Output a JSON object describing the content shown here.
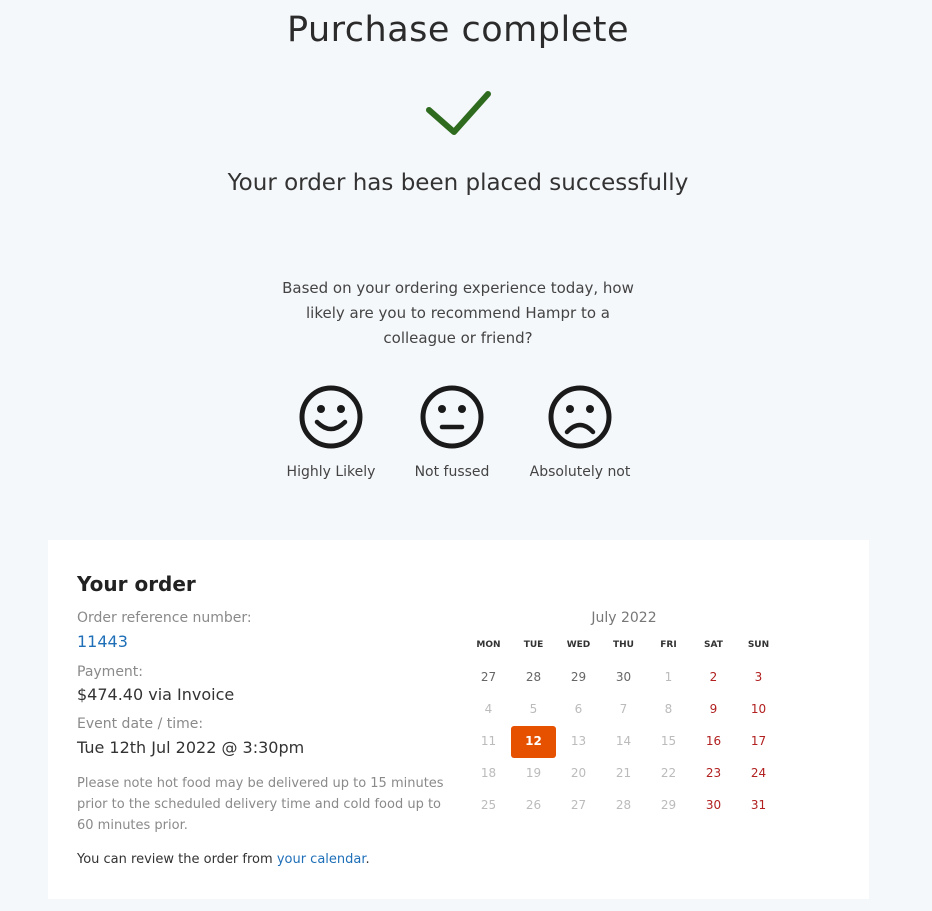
{
  "header": {
    "title": "Purchase complete",
    "subtitle": "Your order has been placed successfully",
    "check_color": "#2e6b1f"
  },
  "survey": {
    "question": "Based on your ordering experience today, how likely are you to recommend Hampr to a colleague or friend?",
    "options": [
      {
        "label": "Highly Likely",
        "icon": "happy-face-icon"
      },
      {
        "label": "Not fussed",
        "icon": "neutral-face-icon"
      },
      {
        "label": "Absolutely not",
        "icon": "sad-face-icon"
      }
    ]
  },
  "order": {
    "title": "Your order",
    "reference_label": "Order reference number:",
    "reference_value": "11443",
    "payment_label": "Payment:",
    "payment_value": "$474.40 via Invoice",
    "event_label": "Event date / time:",
    "event_value": "Tue 12th Jul 2022 @ 3:30pm",
    "note": "Please note hot food may be delivered up to 15 minutes prior to the scheduled delivery time and cold food up to 60 minutes prior.",
    "review_prefix": "You can review the order from ",
    "review_link": "your calendar",
    "review_suffix": "."
  },
  "calendar": {
    "month": "July 2022",
    "weekdays": [
      "MON",
      "TUE",
      "WED",
      "THU",
      "FRI",
      "SAT",
      "SUN"
    ],
    "weeks": [
      [
        "27",
        "28",
        "29",
        "30",
        "1",
        "2",
        "3"
      ],
      [
        "4",
        "5",
        "6",
        "7",
        "8",
        "9",
        "10"
      ],
      [
        "11",
        "12",
        "13",
        "14",
        "15",
        "16",
        "17"
      ],
      [
        "18",
        "19",
        "20",
        "21",
        "22",
        "23",
        "24"
      ],
      [
        "25",
        "26",
        "27",
        "28",
        "29",
        "30",
        "31"
      ]
    ],
    "selected": "12",
    "selected_color": "#e65100",
    "weekend_color": "#b22020"
  }
}
